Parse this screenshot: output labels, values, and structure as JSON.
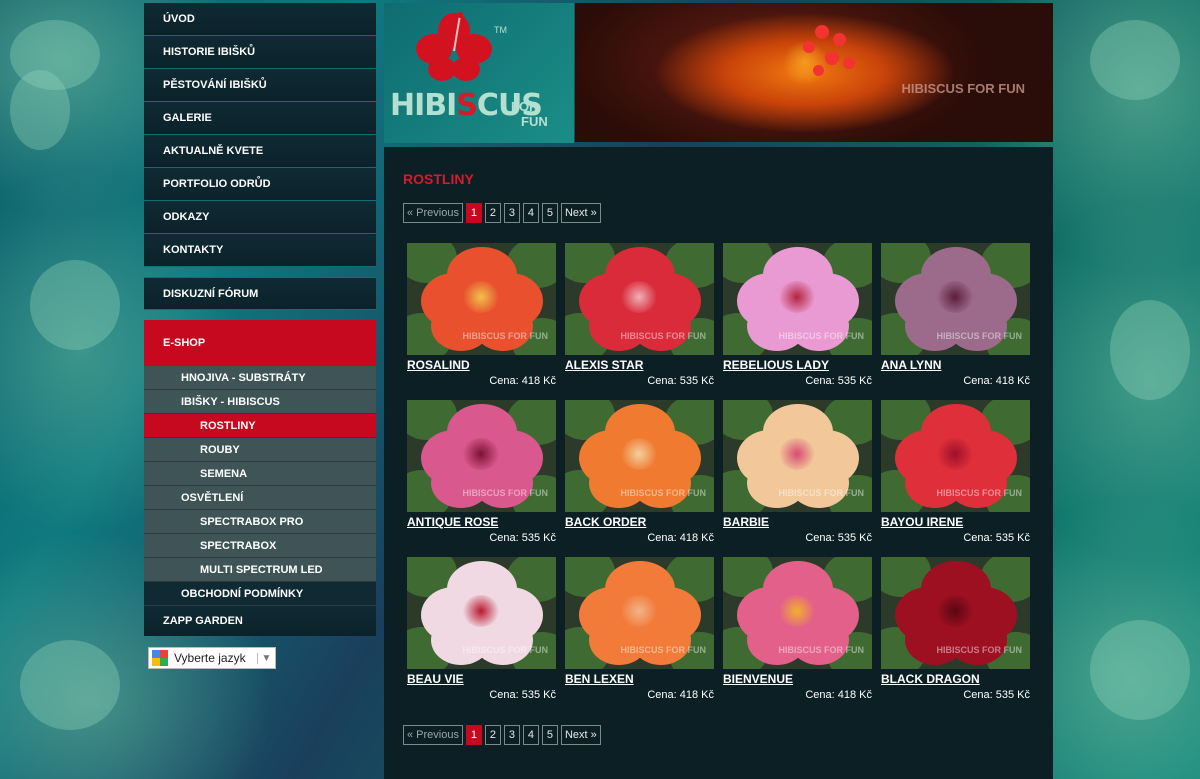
{
  "nav": {
    "main": [
      "ÚVOD",
      "HISTORIE IBIŠKŮ",
      "PĚSTOVÁNÍ IBIŠKŮ",
      "GALERIE",
      "AKTUALNĚ KVETE",
      "PORTFOLIO ODRŮD",
      "ODKAZY",
      "KONTAKTY"
    ],
    "forum": "DISKUZNÍ FÓRUM",
    "eshop": "E-SHOP",
    "sub": [
      {
        "label": "HNOJIVA - SUBSTRÁTY",
        "level": 1
      },
      {
        "label": "IBIŠKY - HIBISCUS",
        "level": 1
      },
      {
        "label": "ROSTLINY",
        "level": 2,
        "active": true
      },
      {
        "label": "ROUBY",
        "level": 2
      },
      {
        "label": "SEMENA",
        "level": 2
      },
      {
        "label": "OSVĚTLENÍ",
        "level": 1
      },
      {
        "label": "SPECTRABOX PRO",
        "level": 2
      },
      {
        "label": "SPECTRABOX",
        "level": 2
      },
      {
        "label": "MULTI SPECTRUM LED",
        "level": 2
      },
      {
        "label": "OBCHODNÍ PODMÍNKY",
        "level": 1,
        "dark": true
      }
    ],
    "zapp": "ZAPP GARDEN"
  },
  "language": {
    "label": "Vyberte jazyk",
    "arrow": "▼"
  },
  "logo": {
    "word": "HIBI",
    "s": "S",
    "rest": "CUS",
    "for_line1": "FOR",
    "for_line2": "FUN",
    "tm": "TM"
  },
  "banner": {
    "watermark": "HIBISCUS FOR FUN"
  },
  "content": {
    "title": "ROSTLINY"
  },
  "pager": {
    "prev": "« Previous",
    "pages": [
      "1",
      "2",
      "3",
      "4",
      "5"
    ],
    "active": "1",
    "next": "Next »"
  },
  "products": [
    {
      "name": "ROSALIND",
      "price": "Cena: 418 Kč",
      "color": "#e8502e",
      "center": "#f2c14a"
    },
    {
      "name": "ALEXIS STAR",
      "price": "Cena: 535 Kč",
      "color": "#d92b3a",
      "center": "#f0b0b5"
    },
    {
      "name": "REBELIOUS LADY",
      "price": "Cena: 535 Kč",
      "color": "#e99ad2",
      "center": "#b5243e"
    },
    {
      "name": "ANA LYNN",
      "price": "Cena: 418 Kč",
      "color": "#9c6a8a",
      "center": "#5d1e3c"
    },
    {
      "name": "ANTIQUE ROSE",
      "price": "Cena: 535 Kč",
      "color": "#d9588d",
      "center": "#7c1234"
    },
    {
      "name": "BACK ORDER",
      "price": "Cena: 418 Kč",
      "color": "#f07a30",
      "center": "#f3d0a0"
    },
    {
      "name": "BARBIE",
      "price": "Cena: 535 Kč",
      "color": "#f2c89a",
      "center": "#d84a72"
    },
    {
      "name": "BAYOU IRENE",
      "price": "Cena: 535 Kč",
      "color": "#de2f3a",
      "center": "#9d102a"
    },
    {
      "name": "BEAU VIE",
      "price": "Cena: 535 Kč",
      "color": "#f0d9e2",
      "center": "#b8182f"
    },
    {
      "name": "BEN LEXEN",
      "price": "Cena: 418 Kč",
      "color": "#f27b3a",
      "center": "#f3b48a"
    },
    {
      "name": "BIENVENUE",
      "price": "Cena: 418 Kč",
      "color": "#e2608a",
      "center": "#f2b02e"
    },
    {
      "name": "BLACK DRAGON",
      "price": "Cena: 535 Kč",
      "color": "#9c1022",
      "center": "#5a0612"
    }
  ],
  "thumb_watermark": "HIBISCUS FOR FUN"
}
